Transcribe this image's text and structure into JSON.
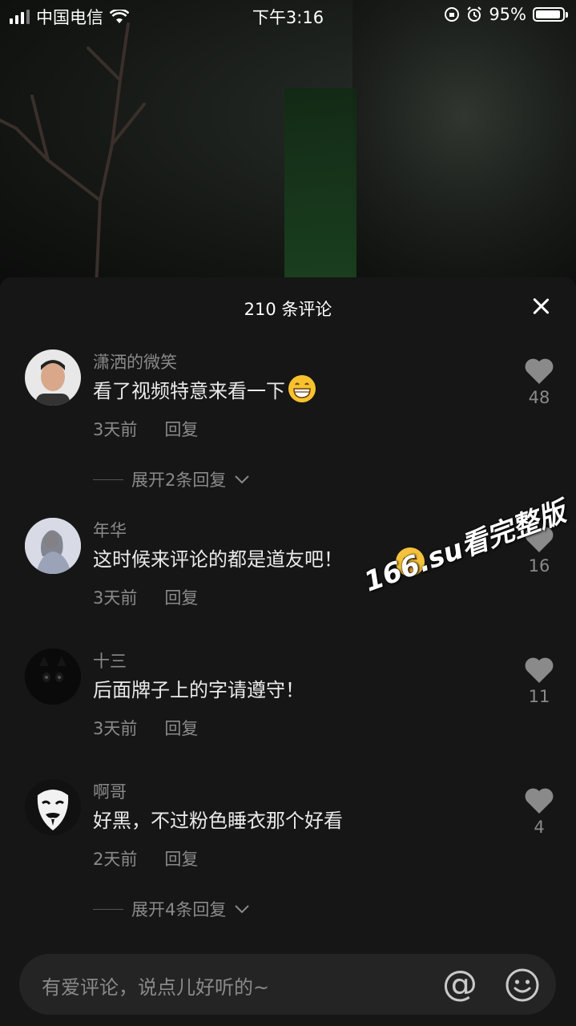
{
  "status_bar": {
    "carrier": "中国电信",
    "time": "下午3:16",
    "battery": "95%",
    "battery_level": 0.95
  },
  "sheet": {
    "title": "210 条评论",
    "close_icon": "close-icon"
  },
  "comments": [
    {
      "username": "潇洒的微笑",
      "content": "看了视频特意来看一下",
      "emoji": "grin",
      "time": "3天前",
      "reply": "回复",
      "likes": "48",
      "expand": "展开2条回复"
    },
    {
      "username": "年华",
      "content": "这时候来评论的都是道友吧！",
      "time": "3天前",
      "reply": "回复",
      "likes": "16"
    },
    {
      "username": "十三",
      "content": "后面牌子上的字请遵守！",
      "time": "3天前",
      "reply": "回复",
      "likes": "11"
    },
    {
      "username": "啊哥",
      "content": "好黑，不过粉色睡衣那个好看",
      "time": "2天前",
      "reply": "回复",
      "likes": "4",
      "expand": "展开4条回复"
    }
  ],
  "watermark": "166.su看完整版",
  "input": {
    "placeholder": "有爱评论，说点儿好听的~",
    "at_symbol": "@"
  }
}
